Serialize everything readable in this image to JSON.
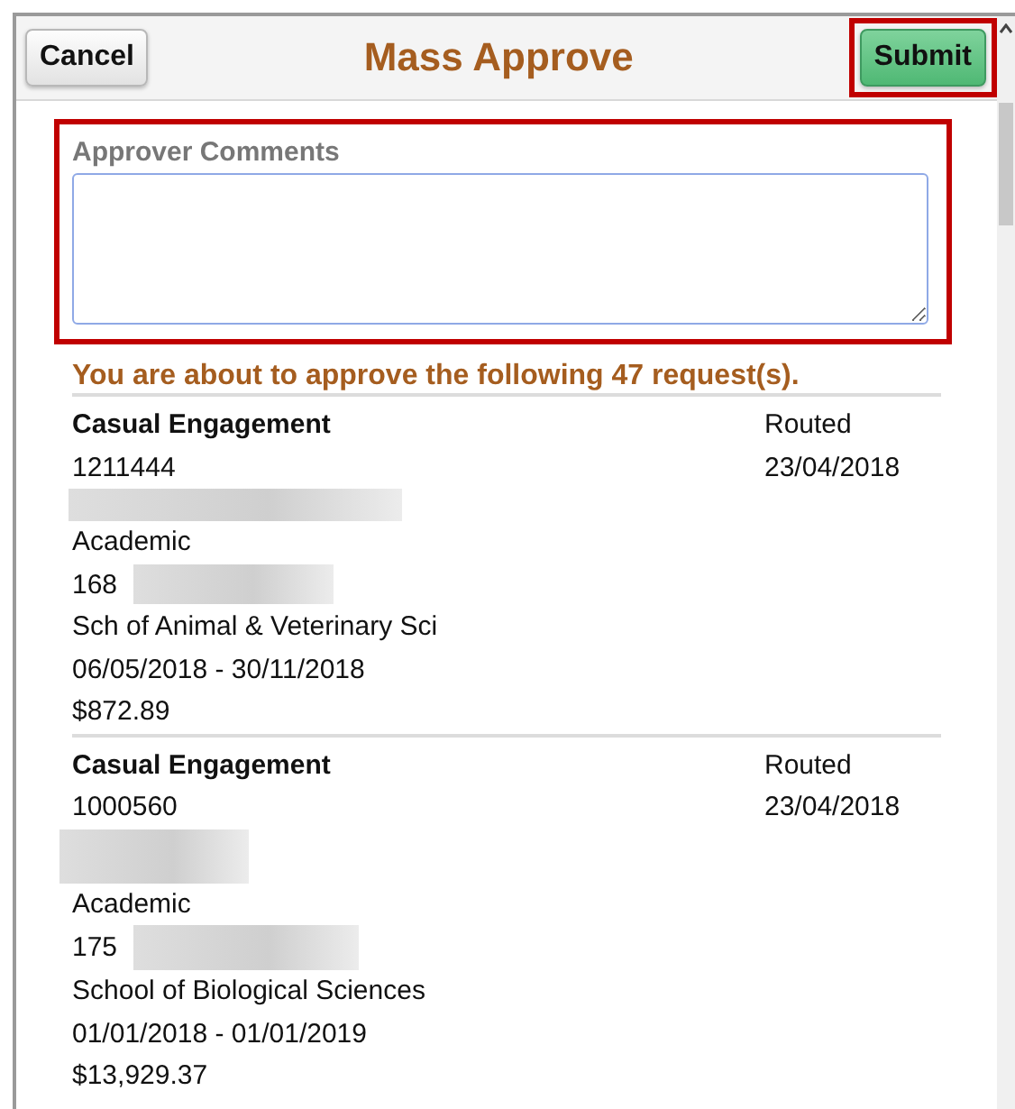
{
  "header": {
    "title": "Mass Approve",
    "cancel_button": "Cancel",
    "submit_button": "Submit"
  },
  "comments": {
    "label": "Approver Comments"
  },
  "notice": "You are about to approve the following 47 request(s).",
  "requests": [
    {
      "type": "Casual Engagement",
      "id": "1211444",
      "status": "Routed",
      "date": "23/04/2018",
      "category": "Academic",
      "code": "168",
      "department": "Sch of Animal & Veterinary Sci",
      "period": "06/05/2018 - 30/11/2018",
      "amount": "$872.89"
    },
    {
      "type": "Casual Engagement",
      "id": "1000560",
      "status": "Routed",
      "date": "23/04/2018",
      "category": "Academic",
      "code": "175",
      "department": "School of Biological Sciences",
      "period": "01/01/2018 - 01/01/2019",
      "amount": "$13,929.37"
    }
  ]
}
